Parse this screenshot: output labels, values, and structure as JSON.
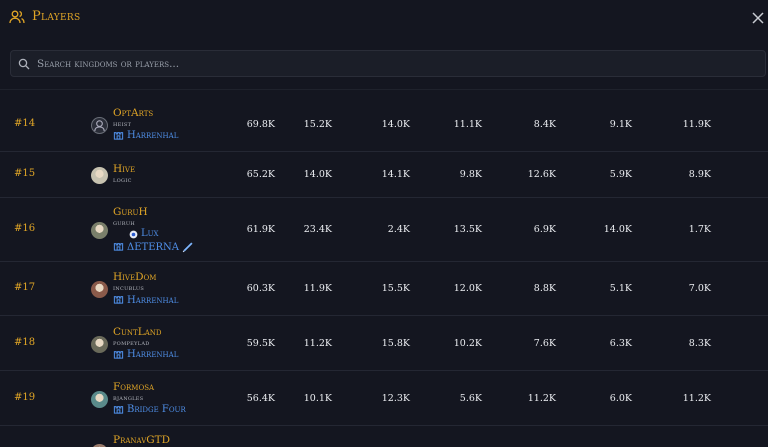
{
  "header": {
    "title": "Players",
    "close_label": "×"
  },
  "search": {
    "placeholder": "Search kingdoms or players..."
  },
  "rows": [
    {
      "rank": "#14",
      "name": "OptArts",
      "sub": "heist",
      "kingdom": "Harrenhal",
      "values": [
        "69.8K",
        "15.2K",
        "14.0K",
        "11.1K",
        "8.4K",
        "9.1K",
        "11.9K"
      ]
    },
    {
      "rank": "#15",
      "name": "Hive",
      "sub": "logic",
      "kingdom": "",
      "values": [
        "65.2K",
        "14.0K",
        "14.1K",
        "9.8K",
        "12.6K",
        "5.9K",
        "8.9K"
      ]
    },
    {
      "rank": "#16",
      "name": "GuruH",
      "sub": "guruh",
      "kingdom": "Lux",
      "kingdom2": "ΔETERNA",
      "values": [
        "61.9K",
        "23.4K",
        "2.4K",
        "13.5K",
        "6.9K",
        "14.0K",
        "1.7K"
      ]
    },
    {
      "rank": "#17",
      "name": "HiveDom",
      "sub": "incublus",
      "kingdom": "Harrenhal",
      "values": [
        "60.3K",
        "11.9K",
        "15.5K",
        "12.0K",
        "8.8K",
        "5.1K",
        "7.0K"
      ]
    },
    {
      "rank": "#18",
      "name": "CuntLand",
      "sub": "pompeylad",
      "kingdom": "Harrenhal",
      "values": [
        "59.5K",
        "11.2K",
        "15.8K",
        "10.2K",
        "7.6K",
        "6.3K",
        "8.3K"
      ]
    },
    {
      "rank": "#19",
      "name": "Formosa",
      "sub": "bjangles",
      "kingdom": "Bridge Four",
      "values": [
        "56.4K",
        "10.1K",
        "12.3K",
        "5.6K",
        "11.2K",
        "6.0K",
        "11.2K"
      ]
    },
    {
      "rank": "",
      "name": "PranavGTD",
      "sub": "",
      "kingdom": "",
      "values": [
        "",
        "",
        "",
        "",
        "",
        "",
        ""
      ]
    }
  ],
  "colors": {
    "accent": "#e0a526",
    "link": "#4f8fe8",
    "bg": "#141620"
  }
}
